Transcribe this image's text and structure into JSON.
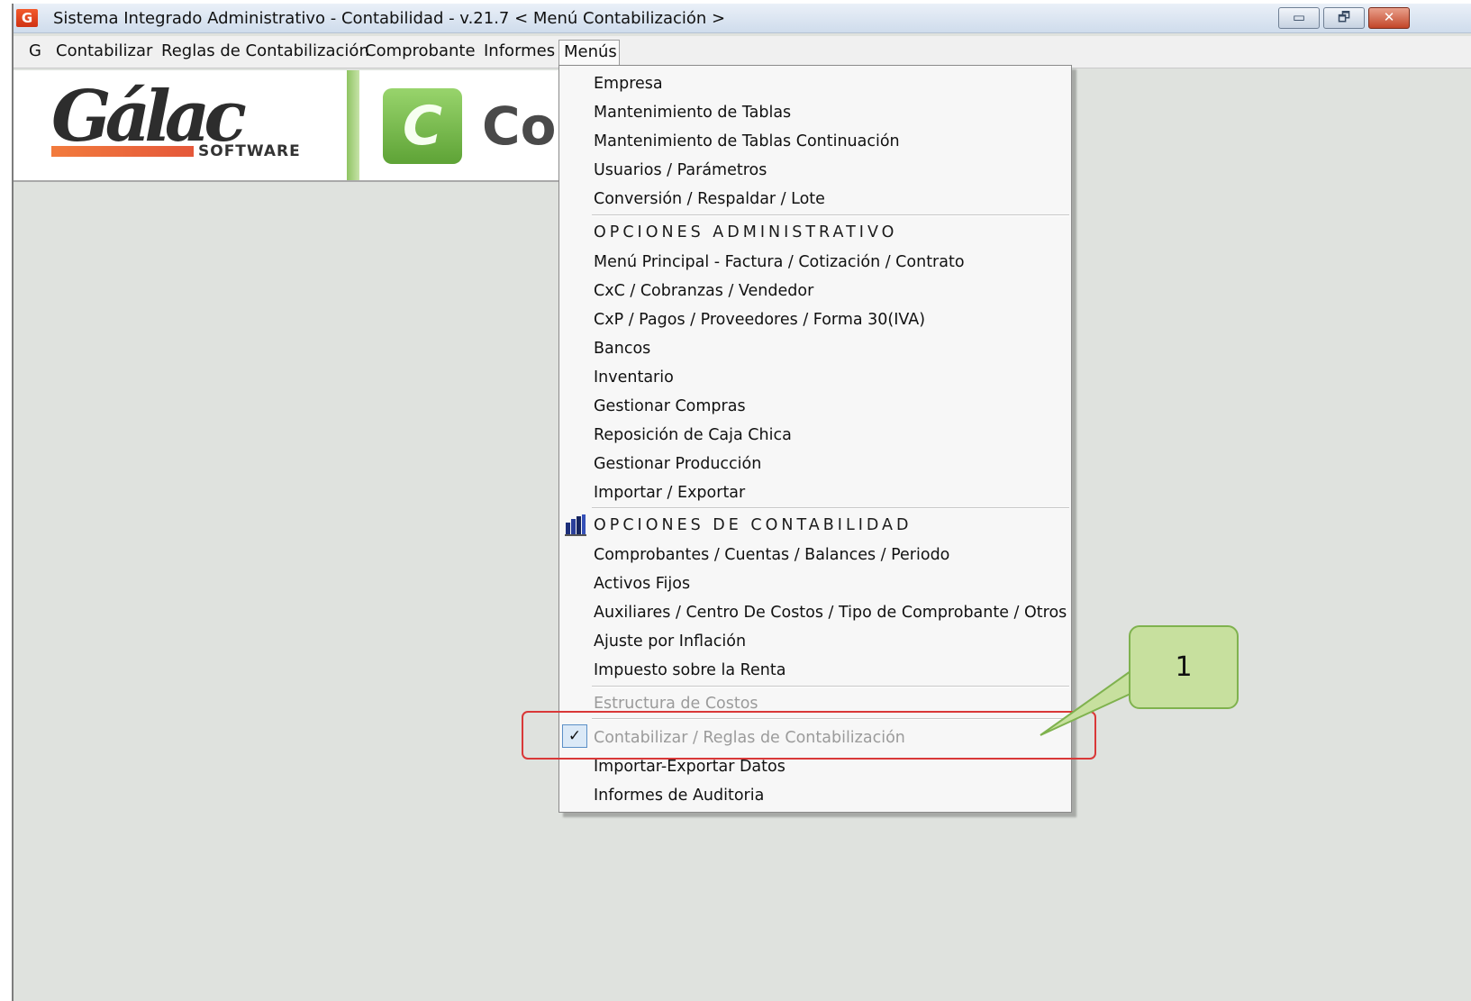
{
  "window": {
    "title": "Sistema Integrado Administrativo - Contabilidad - v.21.7 < Menú Contabilización >",
    "app_icon": "G",
    "controls": {
      "minimize": "▭",
      "restore": "🗗",
      "close": "✕"
    }
  },
  "menubar": {
    "items": [
      "G",
      "Contabilizar",
      "Reglas de Contabilización",
      "Comprobante",
      "Informes",
      "Menús"
    ],
    "open_item": "Menús"
  },
  "banner": {
    "logo_word": "Gálac",
    "logo_sub": "SOFTWARE",
    "c_logo": "C",
    "partial_text": "Co"
  },
  "dropdown": {
    "group1": [
      "Empresa",
      "Mantenimiento de Tablas",
      "Mantenimiento de Tablas Continuación",
      "Usuarios / Parámetros",
      "Conversión / Respaldar / Lote"
    ],
    "header_admin": "OPCIONES ADMINISTRATIVO",
    "group2": [
      "Menú Principal - Factura / Cotización / Contrato",
      "CxC / Cobranzas / Vendedor",
      "CxP / Pagos / Proveedores / Forma 30(IVA)",
      "Bancos",
      "Inventario",
      "Gestionar Compras",
      "Reposición de Caja Chica",
      "Gestionar Producción",
      "Importar / Exportar"
    ],
    "header_contab": "OPCIONES DE CONTABILIDAD",
    "group3": [
      "Comprobantes / Cuentas / Balances / Periodo",
      "Activos Fijos",
      "Auxiliares / Centro De Costos / Tipo de Comprobante / Otros",
      "Ajuste por Inflación",
      "Impuesto sobre la Renta"
    ],
    "estructura": "Estructura de Costos",
    "checked_item": "Contabilizar / Reglas de Contabilización",
    "check_mark": "✓",
    "group4": [
      "Importar-Exportar Datos",
      "Informes de Auditoria"
    ],
    "contab_icon": "books-icon"
  },
  "callout": {
    "number": "1"
  },
  "colors": {
    "highlight": "#d93838",
    "callout_fill": "#c7e09e",
    "callout_border": "#7fb24e"
  }
}
